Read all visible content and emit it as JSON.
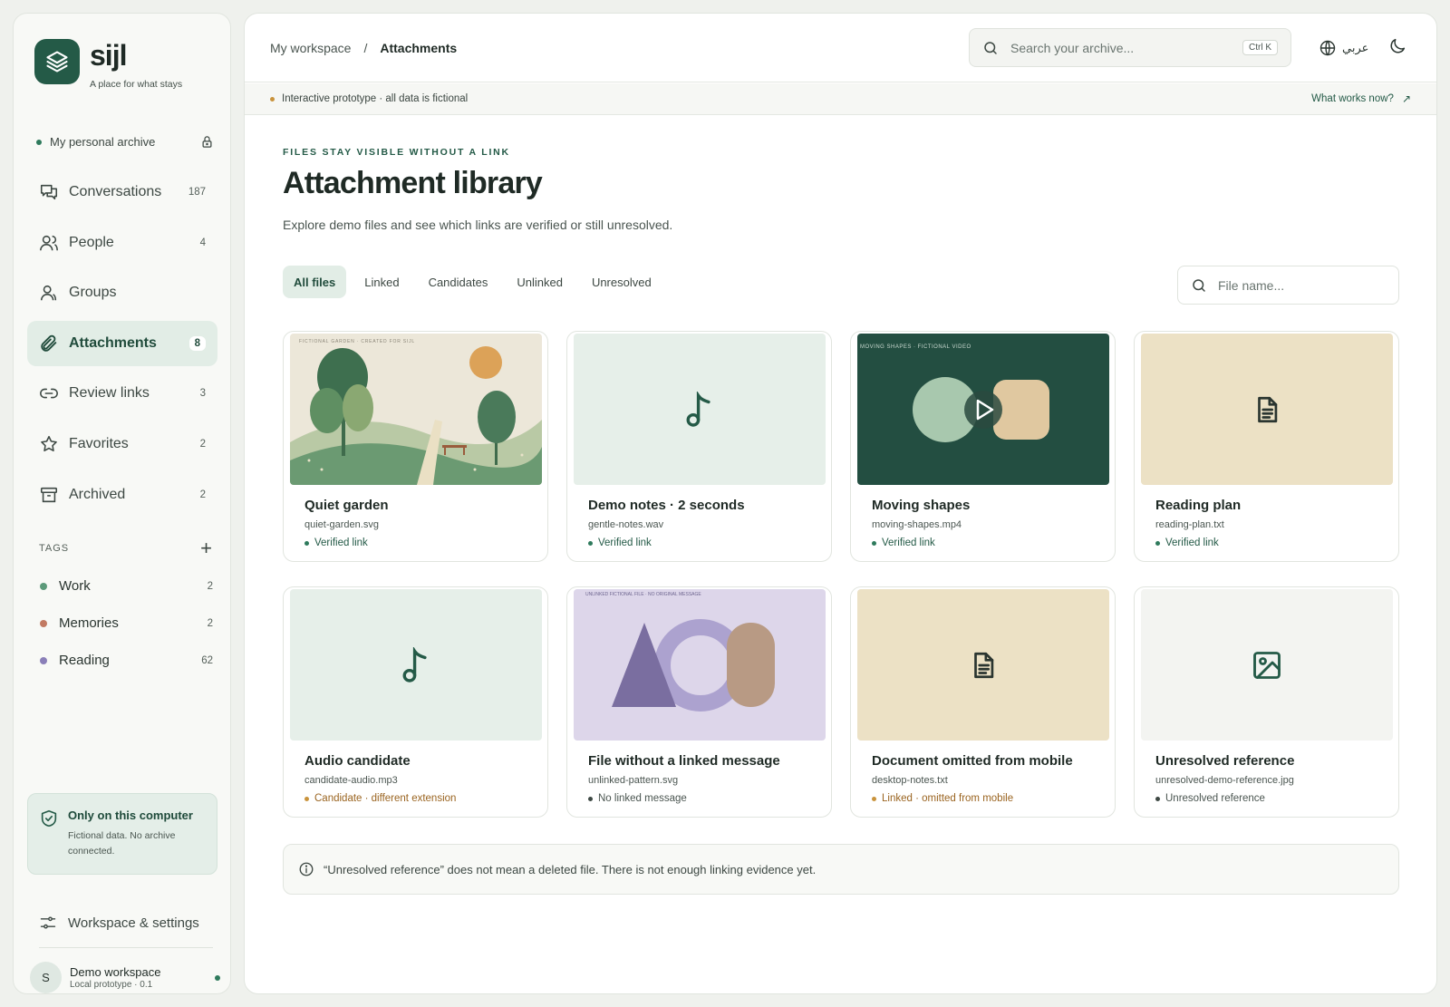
{
  "brand": {
    "name": "sijl",
    "tagline": "A place for what stays"
  },
  "archive": {
    "label": "My personal archive"
  },
  "nav": [
    {
      "label": "Conversations",
      "count": "187",
      "icon": "chat-icon"
    },
    {
      "label": "People",
      "count": "4",
      "icon": "person-icon"
    },
    {
      "label": "Groups",
      "count": "",
      "icon": "group-icon"
    },
    {
      "label": "Attachments",
      "count": "8",
      "icon": "paperclip-icon",
      "active": true
    },
    {
      "label": "Review links",
      "count": "3",
      "icon": "link-icon"
    },
    {
      "label": "Favorites",
      "count": "2",
      "icon": "star-icon"
    },
    {
      "label": "Archived",
      "count": "2",
      "icon": "archive-box-icon"
    }
  ],
  "tags": {
    "heading": "TAGS",
    "items": [
      {
        "label": "Work",
        "count": "2",
        "color": "#5c9a7a"
      },
      {
        "label": "Memories",
        "count": "2",
        "color": "#c27a62"
      },
      {
        "label": "Reading",
        "count": "62",
        "color": "#8a7fb8"
      }
    ]
  },
  "local_card": {
    "title": "Only on this computer",
    "text": "Fictional data. No archive connected."
  },
  "settings": {
    "label": "Workspace & settings"
  },
  "user": {
    "initial": "S",
    "name": "Demo workspace",
    "sub": "Local prototype · 0.1"
  },
  "breadcrumb": {
    "root": "My workspace",
    "sep": "/",
    "current": "Attachments"
  },
  "search": {
    "placeholder": "Search your archive...",
    "shortcut": "Ctrl K"
  },
  "language": {
    "label": "عربي"
  },
  "banner": {
    "text": "Interactive prototype · all data is fictional",
    "link": "What works now?",
    "link_arrow": "↗"
  },
  "page": {
    "eyebrow": "FILES STAY VISIBLE WITHOUT A LINK",
    "title": "Attachment library",
    "subtitle": "Explore demo files and see which links are verified or still unresolved."
  },
  "filters": [
    "All files",
    "Linked",
    "Candidates",
    "Unlinked",
    "Unresolved"
  ],
  "file_search": {
    "placeholder": "File name..."
  },
  "cards": [
    {
      "title": "Quiet garden",
      "file": "quiet-garden.svg",
      "status": "Verified link",
      "status_color": "#245a47",
      "dot_color": "#2e7a5c",
      "thumb": "garden",
      "thumb_caption": "FICTIONAL GARDEN · CREATED FOR SIJL"
    },
    {
      "title": "Demo notes · 2 seconds",
      "file": "gentle-notes.wav",
      "status": "Verified link",
      "status_color": "#245a47",
      "dot_color": "#2e7a5c",
      "thumb": "audio"
    },
    {
      "title": "Moving shapes",
      "file": "moving-shapes.mp4",
      "status": "Verified link",
      "status_color": "#245a47",
      "dot_color": "#2e7a5c",
      "thumb": "video",
      "thumb_caption": "MOVING SHAPES · FICTIONAL VIDEO"
    },
    {
      "title": "Reading plan",
      "file": "reading-plan.txt",
      "status": "Verified link",
      "status_color": "#245a47",
      "dot_color": "#2e7a5c",
      "thumb": "doc"
    },
    {
      "title": "Audio candidate",
      "file": "candidate-audio.mp3",
      "status": "Candidate · different extension",
      "status_color": "#9a6420",
      "dot_color": "#c9933c",
      "thumb": "audio"
    },
    {
      "title": "File without a linked message",
      "file": "unlinked-pattern.svg",
      "status": "No linked message",
      "status_color": "#4a5550",
      "dot_color": "#3d4843",
      "thumb": "pattern",
      "thumb_caption": "UNLINKED FICTIONAL FILE · NO ORIGINAL MESSAGE"
    },
    {
      "title": "Document omitted from mobile",
      "file": "desktop-notes.txt",
      "status": "Linked · omitted from mobile",
      "status_color": "#9a6420",
      "dot_color": "#c9933c",
      "thumb": "doc"
    },
    {
      "title": "Unresolved reference",
      "file": "unresolved-demo-reference.jpg",
      "status": "Unresolved reference",
      "status_color": "#4a5550",
      "dot_color": "#3d4843",
      "thumb": "image"
    }
  ],
  "note": {
    "text": "“Unresolved reference” does not mean a deleted file. There is not enough linking evidence yet."
  },
  "colors": {
    "accent": "#245a47",
    "active_bg": "#e2ede6"
  }
}
